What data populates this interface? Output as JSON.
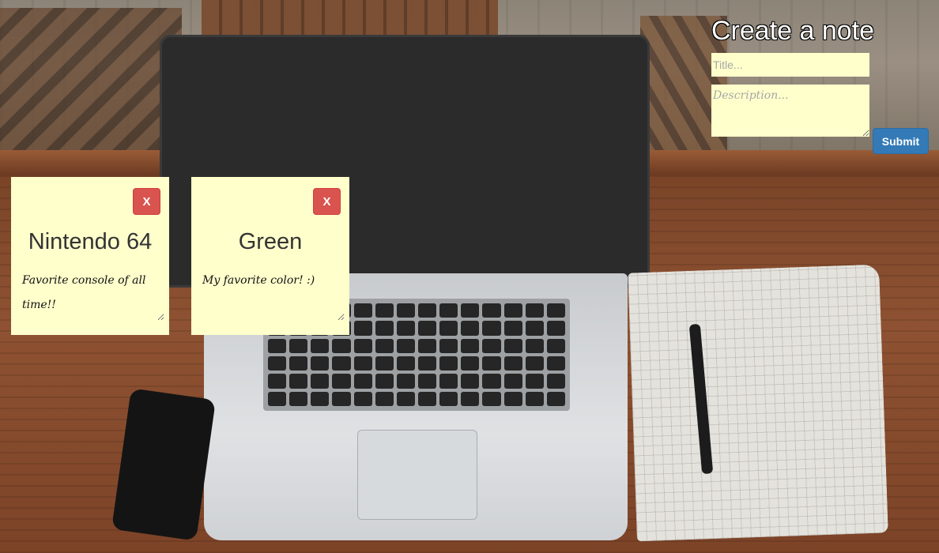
{
  "form": {
    "heading": "Create a note",
    "title_placeholder": "Title...",
    "description_placeholder": "Description...",
    "submit_label": "Submit"
  },
  "notes": [
    {
      "title": "Nintendo 64",
      "description": "Favorite console of all time!!",
      "delete_label": "X"
    },
    {
      "title": "Green",
      "description": "My favorite color! :)",
      "delete_label": "X"
    }
  ],
  "colors": {
    "note_bg": "#ffffcc",
    "submit_bg": "#337ab7",
    "delete_bg": "#d9534f"
  }
}
